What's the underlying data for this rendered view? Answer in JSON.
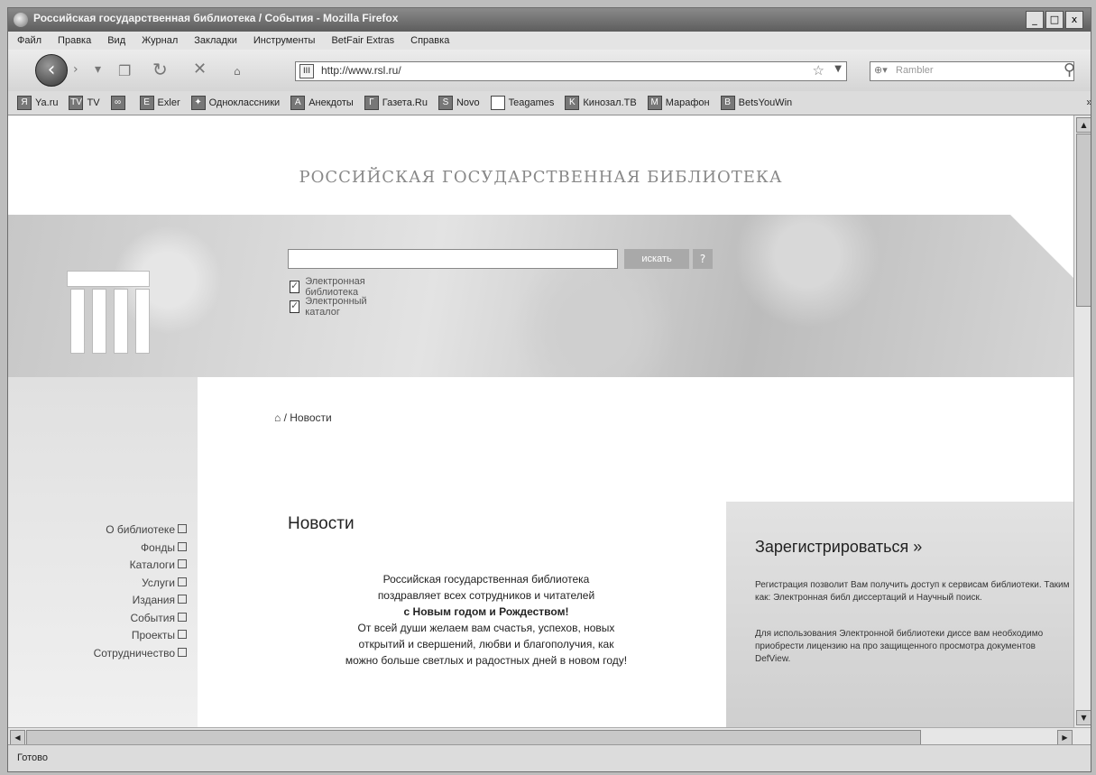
{
  "window": {
    "title": "Российская государственная библиотека / События - Mozilla Firefox",
    "controls": [
      "_",
      "□",
      "x"
    ]
  },
  "menubar": {
    "items": [
      "Файл",
      "Правка",
      "Вид",
      "Журнал",
      "Закладки",
      "Инструменты",
      "BetFair Extras",
      "Справка"
    ]
  },
  "navbar": {
    "url": "http://www.rsl.ru/",
    "search_placeholder": "Rambler"
  },
  "bookmarks": {
    "items": [
      {
        "label": "Ya.ru",
        "icon": "Я"
      },
      {
        "label": "TV",
        "icon": "TV"
      },
      {
        "label": "",
        "icon": "∞"
      },
      {
        "label": "Exler",
        "icon": "E"
      },
      {
        "label": "Одноклассники",
        "icon": "✦"
      },
      {
        "label": "Анекдоты",
        "icon": "A"
      },
      {
        "label": "Газета.Ru",
        "icon": "Г"
      },
      {
        "label": "Novo",
        "icon": "S"
      },
      {
        "label": "Teagames",
        "icon": " "
      },
      {
        "label": "Кинозал.ТВ",
        "icon": "K"
      },
      {
        "label": "Марафон",
        "icon": "M"
      },
      {
        "label": "BetsYouWin",
        "icon": "B"
      }
    ],
    "more": "»"
  },
  "site": {
    "name": "РОССИЙСКАЯ ГОСУДАРСТВЕННАЯ БИБЛИОТЕКА",
    "search_button": "искать",
    "help_button": "?",
    "checkboxes": [
      {
        "label": "Электронная библиотека",
        "checked": true
      },
      {
        "label": "Электронный каталог",
        "checked": true
      }
    ],
    "breadcrumb": "/ Новости",
    "sidenav": [
      "О библиотеке",
      "Фонды",
      "Каталоги",
      "Услуги",
      "Издания",
      "События",
      "Проекты",
      "Сотрудничество"
    ],
    "page_title": "Новости",
    "greeting": {
      "line1": "Российская государственная библиотека",
      "line2": "поздравляет всех сотрудников и читателей",
      "line3": "с Новым годом и Рождеством!",
      "line4": "От всей души желаем вам счастья, успехов, новых",
      "line5": "открытий и свершений, любви и благополучия, как",
      "line6": "можно больше светлых и радостных дней в новом году!"
    },
    "register": {
      "title": "Зарегистрироваться »",
      "text1": "Регистрация позволит Вам получить доступ к сервисам библиотеки. Таким как: Электронная библ диссертаций и Научный поиск.",
      "text2": "Для использования Электронной библиотеки диссе вам необходимо приобрести лицензию на про защищенного просмотра документов DefView."
    }
  },
  "status": {
    "text": "Готово"
  }
}
